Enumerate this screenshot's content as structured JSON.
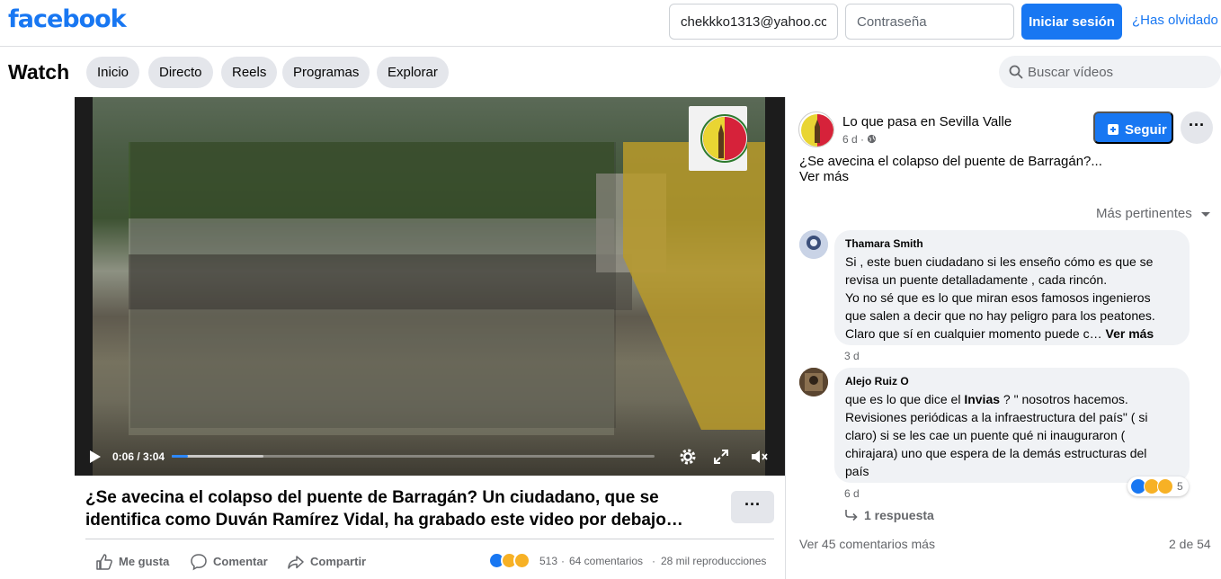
{
  "header": {
    "logo": "facebook",
    "email_value": "chekkko1313@yahoo.cc",
    "password_placeholder": "Contraseña",
    "login_button": "Iniciar sesión",
    "forgot_link": "¿Has olvidado la contraseña?"
  },
  "watch": {
    "title": "Watch",
    "tabs": [
      "Inicio",
      "Directo",
      "Reels",
      "Programas",
      "Explorar"
    ],
    "search_placeholder": "Buscar vídeos"
  },
  "video": {
    "current_time": "0:06",
    "duration": "3:04",
    "time_display": "0:06 / 3:04",
    "progress_fraction": 0.033,
    "buffered_fraction": 0.19
  },
  "post": {
    "title_line1": "¿Se avecina el colapso del puente de Barragán? Un ciudadano, que se",
    "title_line2": "identifica como Duván Ramírez Vidal, ha grabado este video por debajo…",
    "actions": {
      "like": "Me gusta",
      "comment": "Comentar",
      "share": "Compartir"
    },
    "reaction_count": "513",
    "comments_count": "64 comentarios",
    "views": "28 mil reproducciones",
    "separator": "·"
  },
  "sidebar": {
    "page_name": "Lo que pasa en Sevilla Valle",
    "page_time": "6 d ·",
    "follow_button": "Seguir",
    "post_text": "¿Se avecina el colapso del puente de Barragán?...",
    "see_more": "Ver más",
    "sort_label": "Más pertinentes",
    "comments": [
      {
        "name": "Thamara Smith",
        "lines": [
          "Si , este buen ciudadano si les enseño cómo es que se",
          "revisa un puente detalladamente , cada rincón.",
          "Yo no sé que es lo que miran esos famosos ingenieros",
          "que salen a decir que no hay peligro para los peatones.",
          "Claro que sí en cualquier momento puede c…"
        ],
        "see_more": "Ver más",
        "time": "3 d"
      },
      {
        "name": "Alejo Ruiz O",
        "line1_a": "que es lo que dice el ",
        "line1_b": "Invias",
        "line1_c": " ? \" nosotros hacemos.",
        "lines": [
          "Revisiones periódicas a la infraestructura del país\" ( si",
          "claro) si se les cae un puente qué ni inauguraron (",
          "chirajara) uno que espera de la demás estructuras del",
          "país"
        ],
        "time": "6 d",
        "reaction_count": "5",
        "replies": "1 respuesta"
      }
    ],
    "more_comments": "Ver 45 comentarios más",
    "page_count": "2 de 54"
  },
  "colors": {
    "brand": "#1877f2",
    "pill_bg": "#e4e6eb",
    "secondary_text": "#65676b"
  }
}
